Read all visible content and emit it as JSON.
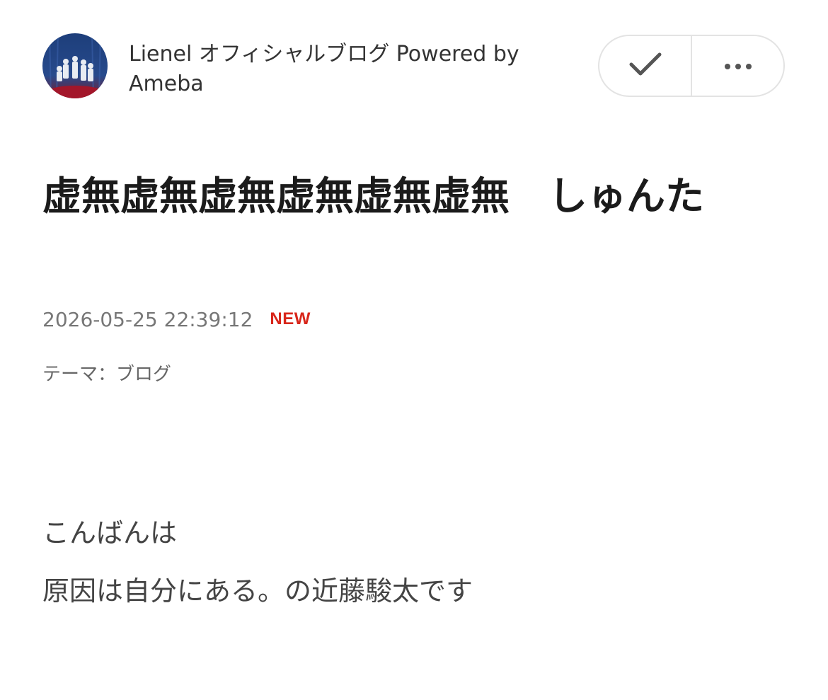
{
  "header": {
    "blog_name": "Lienel オフィシャルブログ Powered by Ameba",
    "avatar_alt": "blog avatar",
    "actions": {
      "check_icon": "checkmark-icon",
      "more_icon": "more-horizontal-icon"
    }
  },
  "article": {
    "title": "虚無虚無虚無虚無虚無虚無　しゅんた",
    "datetime": "2026-05-25 22:39:12",
    "new_badge": "NEW",
    "theme_label": "テーマ：",
    "theme_value": "ブログ",
    "body_lines": [
      "こんばんは",
      "原因は自分にある。の近藤駿太です"
    ]
  },
  "colors": {
    "new_badge": "#d8261a",
    "title": "#1b1b1b",
    "meta": "#777777",
    "pill_border": "#e3e3e3"
  }
}
